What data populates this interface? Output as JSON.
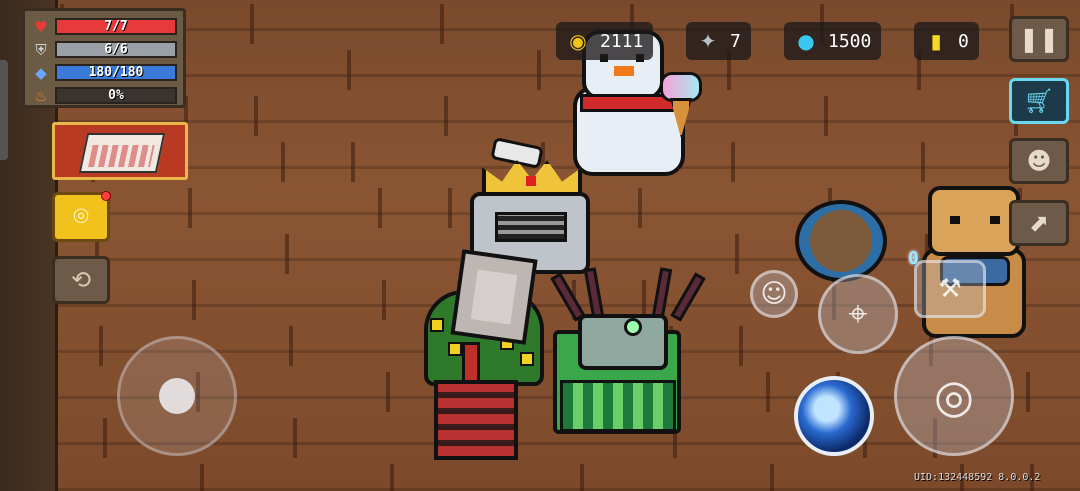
{
  "hud": {
    "health": {
      "text": "7/7",
      "fraction": 1.0,
      "color": "#e83a3a",
      "icon": "heart-icon"
    },
    "armor": {
      "text": "6/6",
      "fraction": 1.0,
      "color": "#9aa0a6",
      "icon": "shield-icon"
    },
    "energy": {
      "text": "180/180",
      "fraction": 1.0,
      "color": "#3a7ad8",
      "icon": "diamond-icon"
    },
    "rage": {
      "text": "0%",
      "fraction": 0.0,
      "color": "#e8742a",
      "icon": "flame-icon"
    }
  },
  "currency": {
    "gold": "2111",
    "fish": "7",
    "gems": "1500",
    "tokens": "0"
  },
  "scene": {
    "floating_text": "0"
  },
  "footer": {
    "uid": "UID:132448592 8.0.0.2"
  },
  "colors": {
    "accent_gold": "#f1c21c",
    "shop_cyan": "#6ad8f0"
  }
}
